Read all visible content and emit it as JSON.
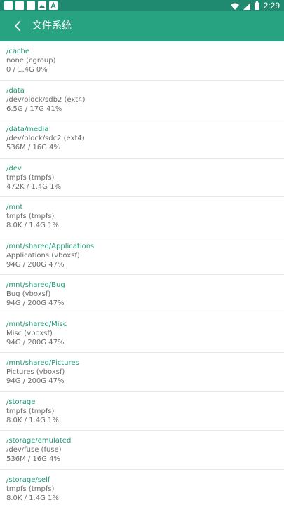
{
  "statusbar": {
    "time": "2:29",
    "icons": [
      "notification-box-icon",
      "notification-box-icon",
      "notification-box-icon",
      "image-icon",
      "text-a-icon"
    ],
    "right_icons": [
      "wifi-icon",
      "cellular-icon",
      "battery-icon"
    ]
  },
  "appbar": {
    "title": "文件系统",
    "back_icon": "chevron-left-icon",
    "background": "#27a382"
  },
  "colors": {
    "accent": "#1f9a79",
    "statusbar": "#1f8a6f",
    "secondary_text": "#6b6b6b"
  },
  "filesystems": [
    {
      "mount": "/cache",
      "device": "none (cgroup)",
      "usage": "0 / 1.4G 0%"
    },
    {
      "mount": "/data",
      "device": "/dev/block/sdb2 (ext4)",
      "usage": "6.5G / 17G 41%"
    },
    {
      "mount": "/data/media",
      "device": "/dev/block/sdc2 (ext4)",
      "usage": "536M / 16G 4%"
    },
    {
      "mount": "/dev",
      "device": "tmpfs (tmpfs)",
      "usage": "472K / 1.4G 1%"
    },
    {
      "mount": "/mnt",
      "device": "tmpfs (tmpfs)",
      "usage": "8.0K / 1.4G 1%"
    },
    {
      "mount": "/mnt/shared/Applications",
      "device": "Applications (vboxsf)",
      "usage": "94G / 200G 47%"
    },
    {
      "mount": "/mnt/shared/Bug",
      "device": "Bug (vboxsf)",
      "usage": "94G / 200G 47%"
    },
    {
      "mount": "/mnt/shared/Misc",
      "device": "Misc (vboxsf)",
      "usage": "94G / 200G 47%"
    },
    {
      "mount": "/mnt/shared/Pictures",
      "device": "Pictures (vboxsf)",
      "usage": "94G / 200G 47%"
    },
    {
      "mount": "/storage",
      "device": "tmpfs (tmpfs)",
      "usage": "8.0K / 1.4G 1%"
    },
    {
      "mount": "/storage/emulated",
      "device": "/dev/fuse (fuse)",
      "usage": "536M / 16G 4%"
    },
    {
      "mount": "/storage/self",
      "device": "tmpfs (tmpfs)",
      "usage": "8.0K / 1.4G 1%"
    }
  ]
}
